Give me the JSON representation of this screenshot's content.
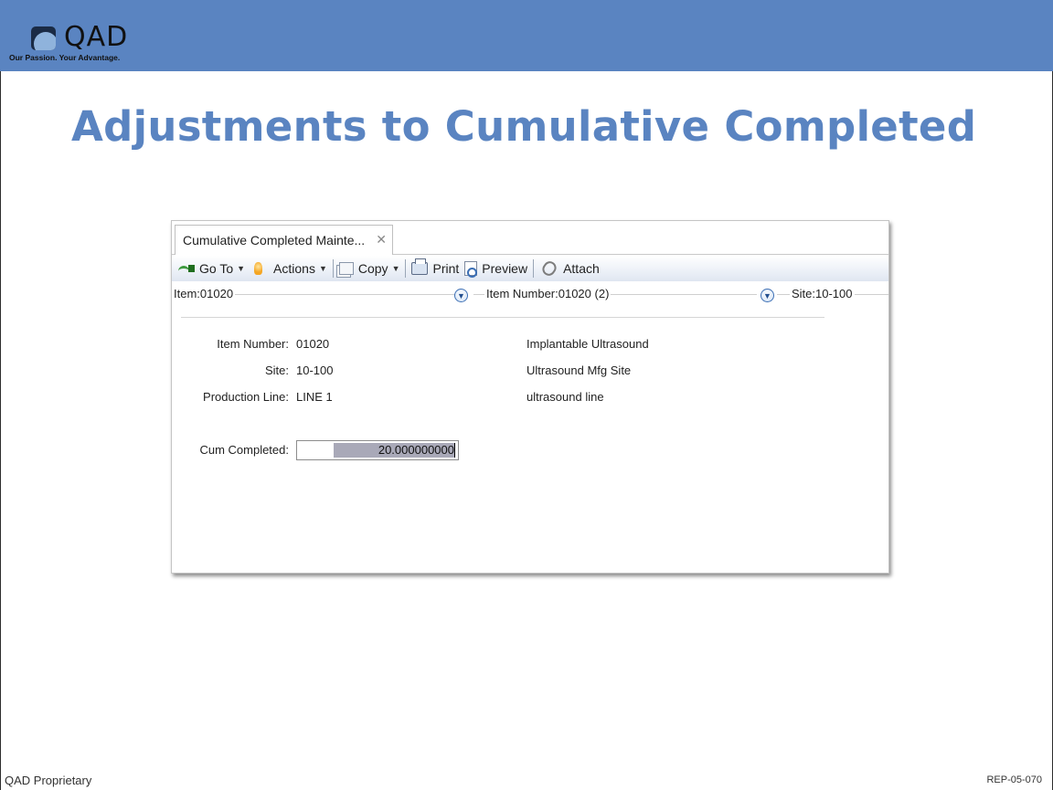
{
  "brand": {
    "logo_text": "QAD",
    "tagline": "Our Passion. Your Advantage.",
    "band_color": "#5a84c1"
  },
  "slide": {
    "title": "Adjustments to Cumulative Completed",
    "footer_left": "QAD Proprietary",
    "footer_right": "REP-05-070"
  },
  "window": {
    "tab_label": "Cumulative Completed Mainte...",
    "tab_close_icon": "close-icon",
    "toolbar": {
      "goto": "Go To",
      "actions": "Actions",
      "copy": "Copy",
      "print": "Print",
      "preview": "Preview",
      "attach": "Attach"
    },
    "breadcrumbs": [
      {
        "label": "Item:01020"
      },
      {
        "label": "Item Number:01020 (2)"
      },
      {
        "label": "Site:10-100"
      }
    ],
    "fields": {
      "item_number": {
        "label": "Item Number:",
        "value": "01020",
        "description": "Implantable Ultrasound"
      },
      "site": {
        "label": "Site:",
        "value": "10-100",
        "description": "Ultrasound Mfg Site"
      },
      "production_line": {
        "label": "Production Line:",
        "value": "LINE 1",
        "description": "ultrasound line"
      },
      "cum_completed": {
        "label": "Cum Completed:",
        "value": "20.000000000"
      }
    }
  }
}
